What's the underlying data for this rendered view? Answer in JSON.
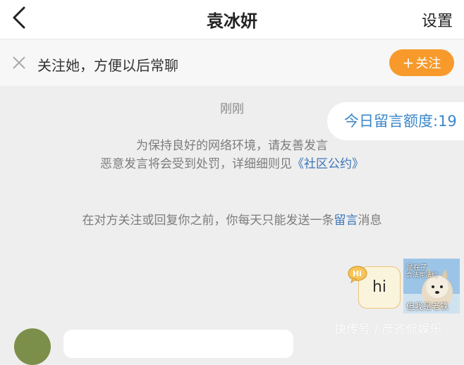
{
  "header": {
    "back_icon": "chevron-left-icon",
    "title": "袁冰妍",
    "settings_label": "设置"
  },
  "follow_bar": {
    "close_icon": "close-icon",
    "text": "关注她，方便以后常聊",
    "button_plus": "+",
    "button_label": "关注",
    "button_color": "#f79a2b"
  },
  "chat": {
    "time": "刚刚",
    "quota": "今日留言额度:19",
    "notice_line1": "为保持良好的网络环境，请友善发言",
    "notice_line2_prefix": "恶意发言将会受到处罚，详细细则见",
    "notice_line2_link": "《社区公约》",
    "notice_line3_prefix": "在对方关注或回复你之前，你每天只能发送一条",
    "notice_line3_link": "留言",
    "notice_line3_suffix": "消息",
    "my_message": "hi",
    "hi_badge": "Hi",
    "avatar_caption_top": "是在子",
    "avatar_caption_mid": "合法宪法约",
    "avatar_caption_bottom": "但我是老铁"
  },
  "watermark": "快传号 / 彦齐侃娱乐",
  "colors": {
    "link": "#3a75b8",
    "quota_text": "#3a86c8",
    "bubble_bg": "#fbf4dc",
    "bubble_border": "#ecc37a"
  }
}
